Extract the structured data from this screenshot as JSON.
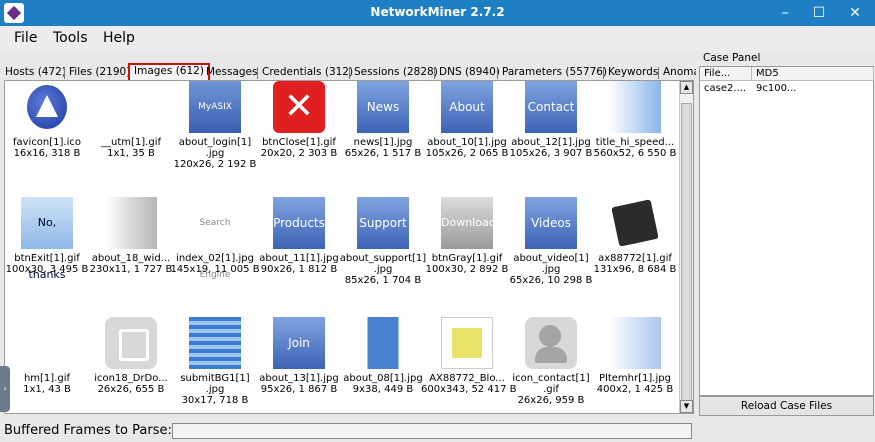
{
  "window": {
    "title": "NetworkMiner 2.7.2"
  },
  "menu": [
    "File",
    "Tools",
    "Help"
  ],
  "tabs": [
    "Hosts (472)",
    "Files (2190)",
    "Images (612)",
    "Messages",
    "Credentials (312)",
    "Sessions (2828)",
    "DNS (8940)",
    "Parameters (55776)",
    "Keywords",
    "Anoma"
  ],
  "active_tab": "Images (612)",
  "images": [
    {
      "label": "favicon[1].ico",
      "label2": "",
      "meta": "16x16, 318 B",
      "icon": "favicon-icon"
    },
    {
      "label": "__utm[1].gif",
      "label2": "",
      "meta": "1x1, 35 B",
      "icon": "blank-image"
    },
    {
      "label": "about_login[1]",
      "label2": ".jpg",
      "meta": "120x26, 2 192 B",
      "icon": "login-banner",
      "thumb_text": "MyASIX Log In"
    },
    {
      "label": "btnClose[1].gif",
      "label2": "",
      "meta": "20x20, 2 303 B",
      "icon": "close-icon"
    },
    {
      "label": "news[1].jpg",
      "label2": "",
      "meta": "65x26, 1 517 B",
      "icon": "news-banner",
      "thumb_text": "News"
    },
    {
      "label": "about_10[1].jpg",
      "label2": "",
      "meta": "105x26, 2 065 B",
      "icon": "about-asix-banner",
      "thumb_text": "About ASIX"
    },
    {
      "label": "about_12[1].jpg",
      "label2": "",
      "meta": "105x26, 3 907 B",
      "icon": "contact-banner",
      "thumb_text": "Contact"
    },
    {
      "label": "title_hi_speed...",
      "label2": "",
      "meta": "560x52, 6 550 B",
      "icon": "title-image"
    },
    {
      "label": "btnExit[1].gif",
      "label2": "",
      "meta": "100x30, 3 495 B",
      "icon": "no-thanks-button",
      "thumb_text": "No, thanks"
    },
    {
      "label": "about_18_wid...",
      "label2": "",
      "meta": "230x11, 1 727 B",
      "icon": "gradient-image"
    },
    {
      "label": "index_02[1].jpg",
      "label2": "",
      "meta": "145x19, 11 005 B",
      "icon": "search-engine-image",
      "thumb_text": "Search Engine"
    },
    {
      "label": "about_11[1].jpg",
      "label2": "",
      "meta": "90x26, 1 812 B",
      "icon": "products-banner",
      "thumb_text": "Products"
    },
    {
      "label": "about_support[1]",
      "label2": ".jpg",
      "meta": "85x26, 1 704 B",
      "icon": "support-banner",
      "thumb_text": "Support"
    },
    {
      "label": "btnGray[1].gif",
      "label2": "",
      "meta": "100x30, 2 892 B",
      "icon": "download-button",
      "thumb_text": "Download"
    },
    {
      "label": "about_video[1]",
      "label2": ".jpg",
      "meta": "65x26, 10 298 B",
      "icon": "videos-banner",
      "thumb_text": "Videos"
    },
    {
      "label": "ax88772[1].gif",
      "label2": "",
      "meta": "131x96, 8 684 B",
      "icon": "chip-image"
    },
    {
      "label": "hm[1].gif",
      "label2": "",
      "meta": "1x1, 43 B",
      "icon": "blank-image"
    },
    {
      "label": "icon18_DrDo...",
      "label2": "",
      "meta": "26x26, 655 B",
      "icon": "floppy-icon"
    },
    {
      "label": "submitBG1[1]",
      "label2": ".jpg",
      "meta": "30x17, 718 B",
      "icon": "submit-bg-image"
    },
    {
      "label": "about_13[1].jpg",
      "label2": "",
      "meta": "95x26, 1 867 B",
      "icon": "join-asix-banner",
      "thumb_text": "Join ASIX"
    },
    {
      "label": "about_08[1].jpg",
      "label2": "",
      "meta": "9x38, 449 B",
      "icon": "bar-image"
    },
    {
      "label": "AX88772_Blo...",
      "label2": "",
      "meta": "600x343, 52 417 B",
      "icon": "block-diagram-image"
    },
    {
      "label": "icon_contact[1]",
      "label2": ".gif",
      "meta": "26x26, 959 B",
      "icon": "contact-icon"
    },
    {
      "label": "Pltemhr[1].jpg",
      "label2": "",
      "meta": "400x2, 1 425 B",
      "icon": "gradient-image"
    }
  ],
  "case_panel": {
    "title": "Case Panel",
    "columns": [
      "File...",
      "MD5"
    ],
    "rows": [
      {
        "file": "case2....",
        "md5": "9c100..."
      }
    ],
    "reload_label": "Reload Case Files"
  },
  "status": {
    "label": "Buffered Frames to Parse:",
    "progress": 0
  }
}
